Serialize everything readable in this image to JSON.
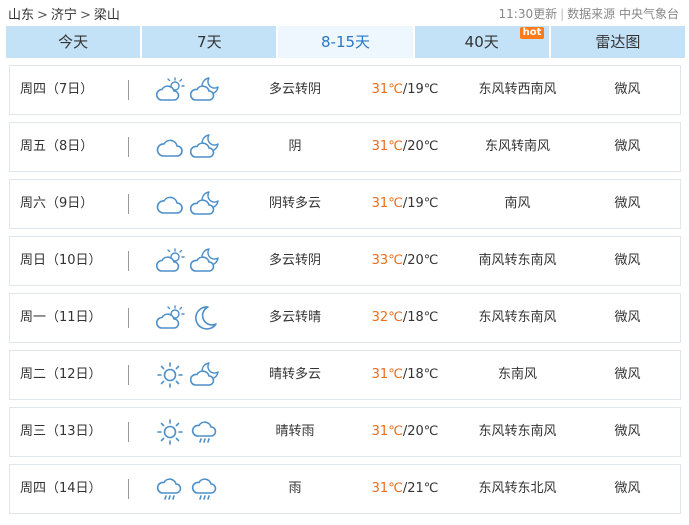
{
  "breadcrumb": {
    "province": "山东",
    "city": "济宁",
    "county": "梁山",
    "sep": ">"
  },
  "meta": {
    "update": "11:30更新",
    "source_label": "数据来源",
    "source": "中央气象台",
    "divider": "|"
  },
  "tabs": [
    {
      "label": "今天",
      "active": false
    },
    {
      "label": "7天",
      "active": false
    },
    {
      "label": "8-15天",
      "active": true
    },
    {
      "label": "40天",
      "active": false,
      "badge": "hot"
    },
    {
      "label": "雷达图",
      "active": false
    }
  ],
  "rows": [
    {
      "day": "周四（7日）",
      "icons": [
        "partly-cloudy-day-icon",
        "partly-cloudy-night-icon"
      ],
      "desc": "多云转阴",
      "hi": "31℃",
      "lo": "/19℃",
      "wind": "东风转西南风",
      "level": "微风"
    },
    {
      "day": "周五（8日）",
      "icons": [
        "cloudy-icon",
        "partly-cloudy-night-icon"
      ],
      "desc": "阴",
      "hi": "31℃",
      "lo": "/20℃",
      "wind": "东风转南风",
      "level": "微风"
    },
    {
      "day": "周六（9日）",
      "icons": [
        "cloudy-icon",
        "partly-cloudy-night-icon"
      ],
      "desc": "阴转多云",
      "hi": "31℃",
      "lo": "/19℃",
      "wind": "南风",
      "level": "微风"
    },
    {
      "day": "周日（10日）",
      "icons": [
        "partly-cloudy-day-icon",
        "partly-cloudy-night-icon"
      ],
      "desc": "多云转阴",
      "hi": "33℃",
      "lo": "/20℃",
      "wind": "南风转东南风",
      "level": "微风"
    },
    {
      "day": "周一（11日）",
      "icons": [
        "partly-cloudy-day-icon",
        "moon-icon"
      ],
      "desc": "多云转晴",
      "hi": "32℃",
      "lo": "/18℃",
      "wind": "东风转东南风",
      "level": "微风"
    },
    {
      "day": "周二（12日）",
      "icons": [
        "sun-icon",
        "partly-cloudy-night-icon"
      ],
      "desc": "晴转多云",
      "hi": "31℃",
      "lo": "/18℃",
      "wind": "东南风",
      "level": "微风"
    },
    {
      "day": "周三（13日）",
      "icons": [
        "sun-icon",
        "rain-icon"
      ],
      "desc": "晴转雨",
      "hi": "31℃",
      "lo": "/20℃",
      "wind": "东风转东南风",
      "level": "微风"
    },
    {
      "day": "周四（14日）",
      "icons": [
        "rain-icon",
        "rain-icon"
      ],
      "desc": "雨",
      "hi": "31℃",
      "lo": "/21℃",
      "wind": "东风转东北风",
      "level": "微风"
    }
  ],
  "colors": {
    "accent": "#2a77c4",
    "tab_bg": "#c3e2f7",
    "tab_active_bg": "#eef7fd",
    "high_temp": "#e86d1d",
    "hot_badge": "#ff7a1a",
    "icon_stroke": "#4d8fc8"
  }
}
